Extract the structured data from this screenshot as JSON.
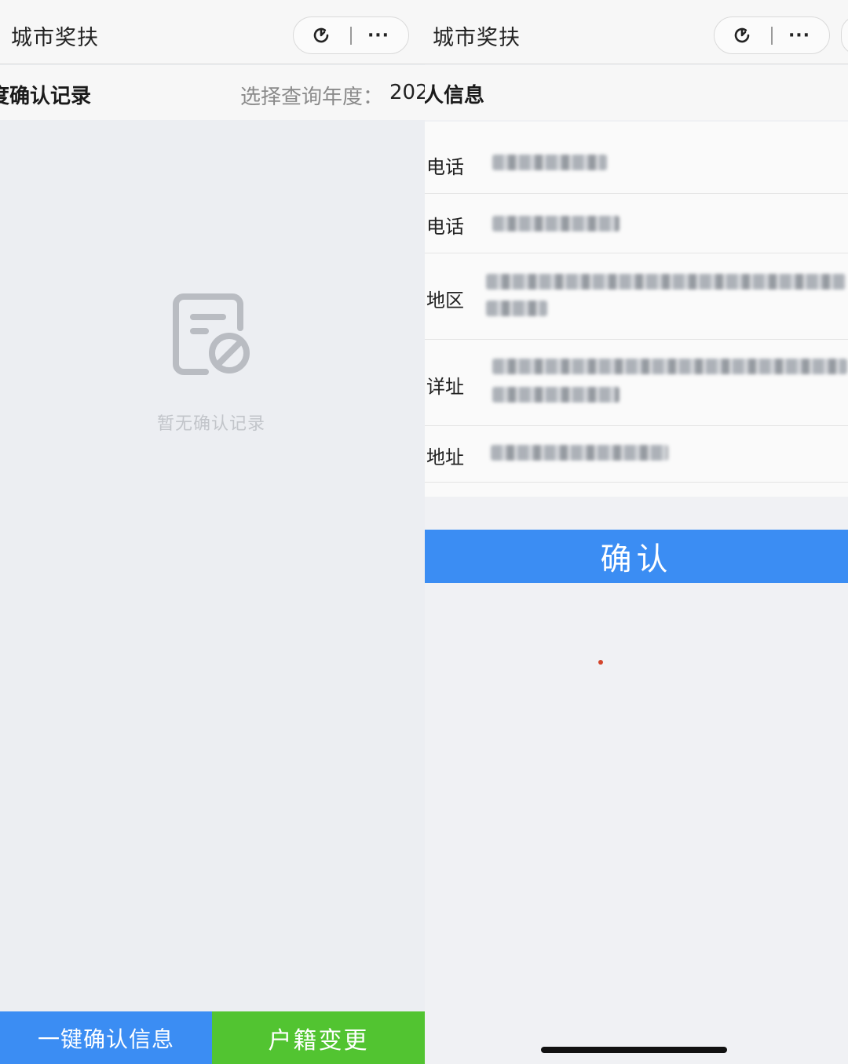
{
  "left": {
    "nav": {
      "title": "城市奖扶",
      "more_label": "···"
    },
    "subbar": {
      "title": "度确认记录",
      "year_label": "选择查询年度：",
      "year_value": "202"
    },
    "empty_text": "暂无确认记录",
    "bottom_buttons": {
      "confirm_all": "一键确认信息",
      "hukou_change": "户籍变更"
    }
  },
  "right": {
    "nav": {
      "title": "城市奖扶",
      "more_label": "···"
    },
    "subbar": {
      "title": "人信息"
    },
    "fields": [
      {
        "label": "电话"
      },
      {
        "label": "电话"
      },
      {
        "label": "地区"
      },
      {
        "label": "详址"
      },
      {
        "label": "地址"
      }
    ],
    "confirm_button": "确认"
  },
  "icons": {
    "refresh": "refresh-icon",
    "more": "more-icon",
    "empty": "empty-record-icon"
  },
  "colors": {
    "primary_blue": "#3b8df3",
    "green": "#52c431",
    "empty_gray": "#c2c5ca"
  }
}
